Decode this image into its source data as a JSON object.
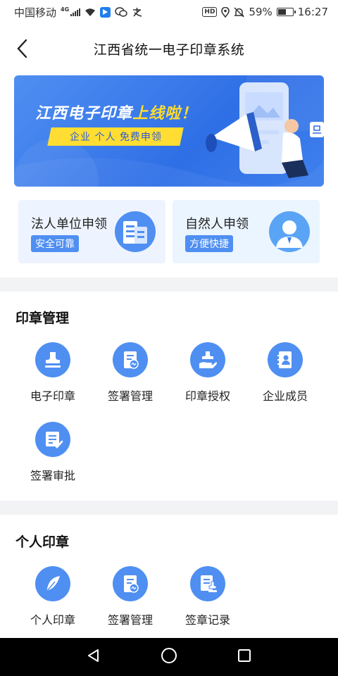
{
  "status_bar": {
    "carrier": "中国移动",
    "network": "4G",
    "battery_percent": "59%",
    "time": "16:27",
    "hd_badge": "HD",
    "battery_level": 0.59,
    "icons": [
      "signal-icon",
      "wifi-icon",
      "blue-app-icon",
      "wechat-icon",
      "alipay-icon",
      "location-icon",
      "mute-icon",
      "battery-icon"
    ]
  },
  "navbar": {
    "title": "江西省统一电子印章系统"
  },
  "banner": {
    "headline_prefix": "江西电子印章",
    "headline_highlight": "上线啦！",
    "tagline": "企业 个人 免费申领"
  },
  "apply_cards": [
    {
      "title": "法人单位申领",
      "badge": "安全可靠",
      "icon": "building-icon"
    },
    {
      "title": "自然人申领",
      "badge": "方便快捷",
      "icon": "person-avatar-icon"
    }
  ],
  "seal_management": {
    "title": "印章管理",
    "items": [
      {
        "label": "电子印章",
        "icon": "stamp-icon"
      },
      {
        "label": "签署管理",
        "icon": "document-sign-icon"
      },
      {
        "label": "印章授权",
        "icon": "hand-stamp-icon"
      },
      {
        "label": "企业成员",
        "icon": "contacts-book-icon"
      },
      {
        "label": "签署审批",
        "icon": "document-check-icon"
      }
    ]
  },
  "personal_seal": {
    "title": "个人印章",
    "items": [
      {
        "label": "个人印章",
        "icon": "feather-pen-icon"
      },
      {
        "label": "签署管理",
        "icon": "document-sign-icon"
      },
      {
        "label": "签章记录",
        "icon": "stamp-record-icon"
      }
    ]
  },
  "colors": {
    "primary": "#4f8ff2",
    "banner_highlight": "#ffdc2e",
    "separator": "#f2f3f5"
  }
}
